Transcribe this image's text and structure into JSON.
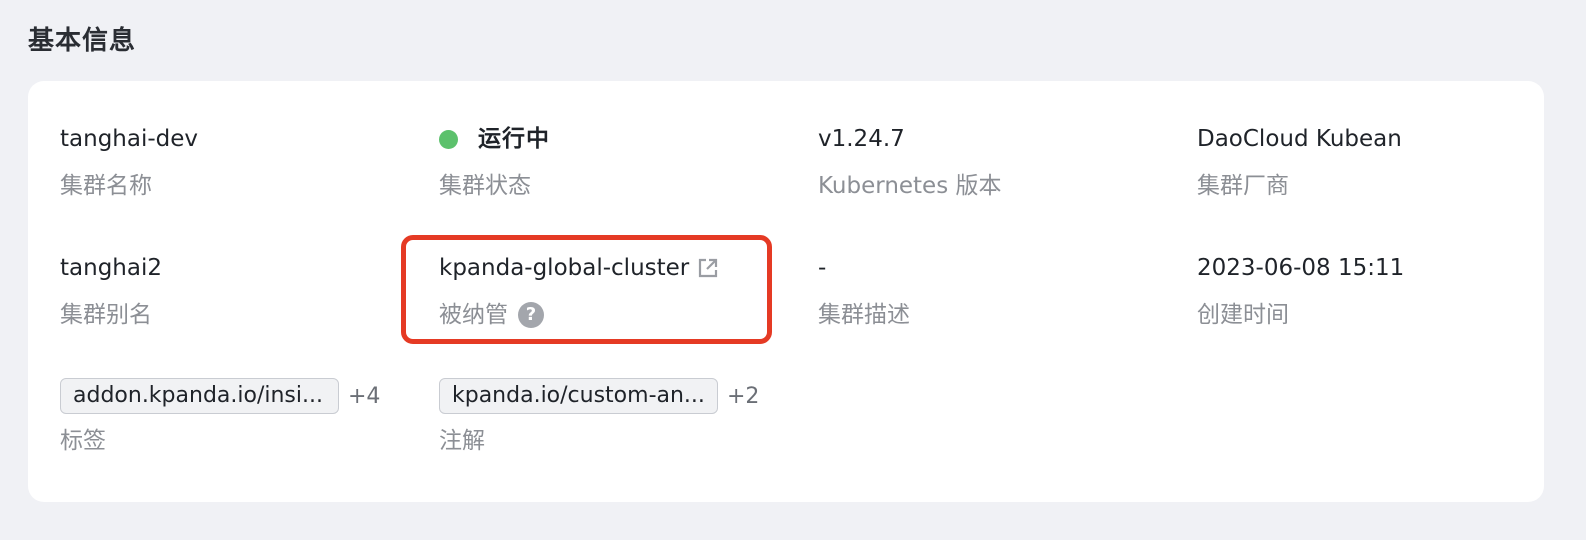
{
  "section": {
    "title": "基本信息"
  },
  "colors": {
    "status_running": "#5cc16c",
    "highlight": "#e53a24"
  },
  "fields": {
    "cluster_name": {
      "value": "tanghai-dev",
      "label": "集群名称"
    },
    "cluster_status": {
      "value": "运行中",
      "label": "集群状态",
      "indicator": "green-dot"
    },
    "k8s_version": {
      "value": "v1.24.7",
      "label": "Kubernetes 版本"
    },
    "vendor": {
      "value": "DaoCloud Kubean",
      "label": "集群厂商"
    },
    "alias": {
      "value": "tanghai2",
      "label": "集群别名"
    },
    "managed_by": {
      "value": "kpanda-global-cluster",
      "label": "被纳管",
      "link_icon": "external-link-icon",
      "help_icon": "question-circle-icon",
      "help_glyph": "?"
    },
    "description": {
      "value": "-",
      "label": "集群描述"
    },
    "created_at": {
      "value": "2023-06-08 15:11",
      "label": "创建时间"
    },
    "labels": {
      "tag": "addon.kpanda.io/insi...",
      "more": "+4",
      "label": "标签"
    },
    "annotations": {
      "tag": "kpanda.io/custom-an...",
      "more": "+2",
      "label": "注解"
    }
  }
}
